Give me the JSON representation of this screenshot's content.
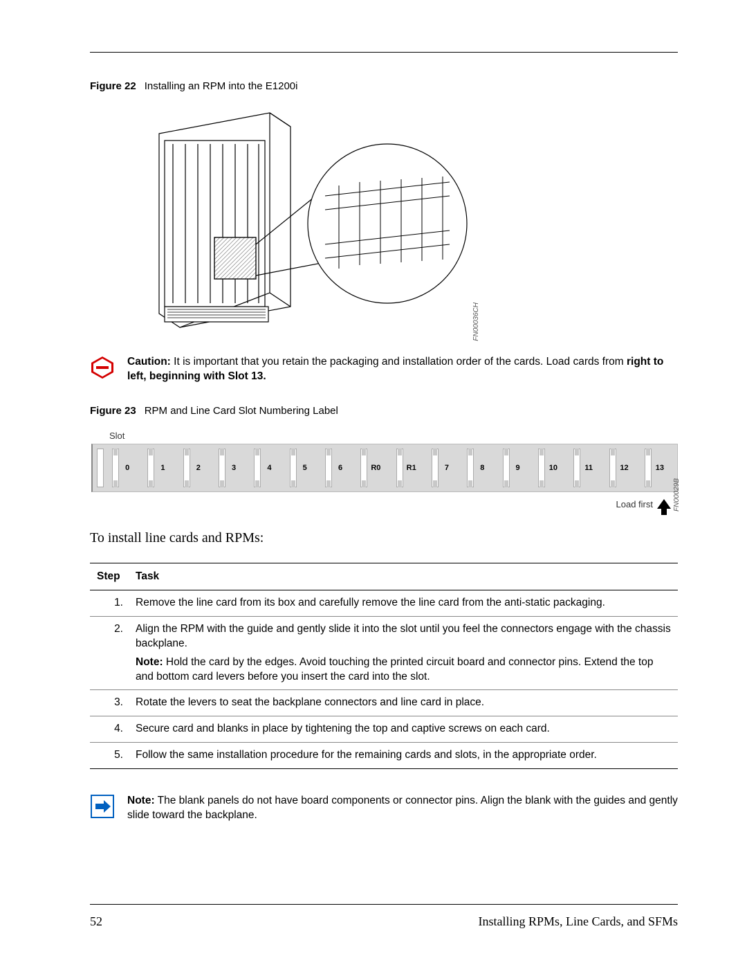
{
  "figure22": {
    "label": "Figure 22",
    "caption": "Installing an RPM into the E1200i",
    "code": "FN00036CH"
  },
  "caution": {
    "label": "Caution:",
    "text_before_bold": " It is important that you retain the packaging and installation order of the cards. Load cards from ",
    "bold1": "right to left, beginning with Slot 13."
  },
  "figure23": {
    "label": "Figure 23",
    "caption": "RPM and Line Card Slot Numbering Label",
    "slot_label": "Slot",
    "slots": [
      "0",
      "1",
      "2",
      "3",
      "4",
      "5",
      "6",
      "R0",
      "R1",
      "7",
      "8",
      "9",
      "10",
      "11",
      "12",
      "13"
    ],
    "load_first": "Load first",
    "code": "FN00029B"
  },
  "body_line": "To install line cards and RPMs:",
  "table": {
    "headers": {
      "step": "Step",
      "task": "Task"
    },
    "rows": [
      {
        "n": "1.",
        "task": "Remove the line card from its box and carefully remove the line card from the anti-static packaging."
      },
      {
        "n": "2.",
        "task": "Align the RPM with the guide and gently slide it into the slot until you feel the connectors engage with the chassis backplane.",
        "note_label": "Note:",
        "note": " Hold the card by the edges. Avoid touching the printed circuit board and connector pins. Extend the top and bottom card levers before you insert the card into the slot."
      },
      {
        "n": "3.",
        "task": "Rotate the levers to seat the backplane connectors and line card in place."
      },
      {
        "n": "4.",
        "task": "Secure card and blanks in place by tightening the top and captive screws on each card."
      },
      {
        "n": "5.",
        "task": "Follow the same installation procedure for the remaining cards and slots, in the appropriate order."
      }
    ]
  },
  "note": {
    "label": "Note:",
    "text": " The blank panels do not have board components or connector pins. Align the blank with the guides and gently slide toward the backplane."
  },
  "footer": {
    "page": "52",
    "title": "Installing RPMs, Line Cards, and SFMs"
  }
}
